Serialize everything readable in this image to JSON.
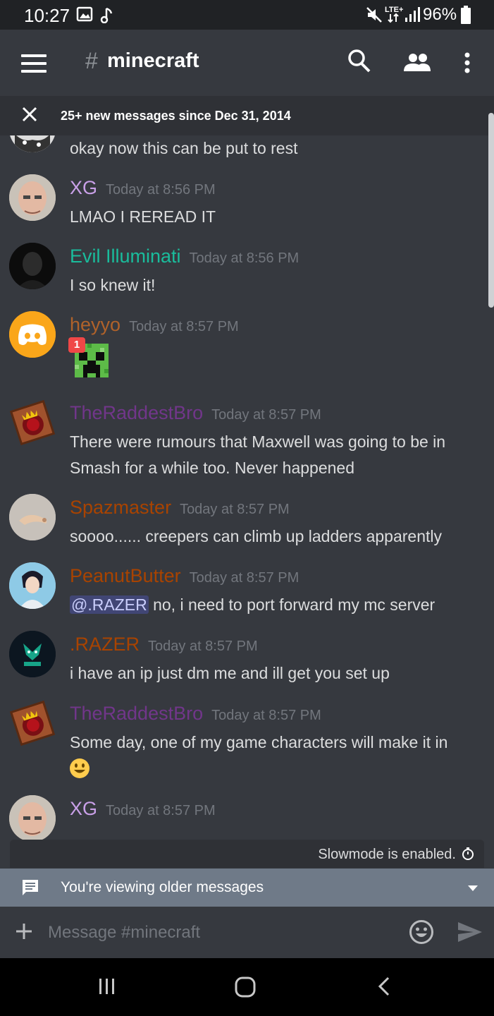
{
  "status_bar": {
    "time": "10:27",
    "battery": "96%",
    "icons": [
      "gallery-icon",
      "music-note-icon",
      "mute-icon",
      "lte-icon",
      "signal-icon",
      "battery-icon"
    ]
  },
  "header": {
    "hash": "#",
    "channel": "minecraft",
    "icons": [
      "menu-icon",
      "search-icon",
      "members-icon",
      "more-vert-icon"
    ]
  },
  "new_messages_bar": {
    "text": "25+ new messages since Dec 31, 2014"
  },
  "messages": [
    {
      "text": "okay now this can be put to rest"
    },
    {
      "username": "XG",
      "user_color": "#c9a0e8",
      "timestamp": "Today at 8:56 PM",
      "text": "LMAO I REREAD IT"
    },
    {
      "username": "Evil Illuminati",
      "user_color": "#1abc9c",
      "timestamp": "Today at 8:56 PM",
      "text": "I so knew it!"
    },
    {
      "username": "heyyo",
      "user_color": "#b0622a",
      "timestamp": "Today at 8:57 PM",
      "attachment_badge": "1"
    },
    {
      "username": "TheRaddestBro",
      "user_color": "#71368a",
      "timestamp": "Today at 8:57 PM",
      "text": "There were rumours that Maxwell was going to be in Smash for a while too. Never happened"
    },
    {
      "username": "Spazmaster",
      "user_color": "#a84300",
      "timestamp": "Today at 8:57 PM",
      "text": "soooo...... creepers can climb up ladders apparently"
    },
    {
      "username": "PeanutButter",
      "user_color": "#a84300",
      "timestamp": "Today at 8:57 PM",
      "mention": "@.RAZER",
      "text": " no, i need to port forward my mc server"
    },
    {
      "username": ".RAZER",
      "user_color": "#a84300",
      "timestamp": "Today at 8:57 PM",
      "text": "i have an ip just dm me and ill get you set up"
    },
    {
      "username": "TheRaddestBro",
      "user_color": "#71368a",
      "timestamp": "Today at 8:57 PM",
      "text": "Some day, one of my game characters will make it in",
      "emoji": "smiley-emoji"
    },
    {
      "username": "XG",
      "user_color": "#c9a0e8",
      "timestamp": "Today at 8:57 PM"
    }
  ],
  "slowmode": {
    "text": "Slowmode is enabled."
  },
  "older_bar": {
    "text": "You're viewing older messages"
  },
  "composer": {
    "placeholder": "Message #minecraft"
  },
  "nav_bar": {
    "icons": [
      "recents-icon",
      "home-icon",
      "back-icon"
    ]
  }
}
